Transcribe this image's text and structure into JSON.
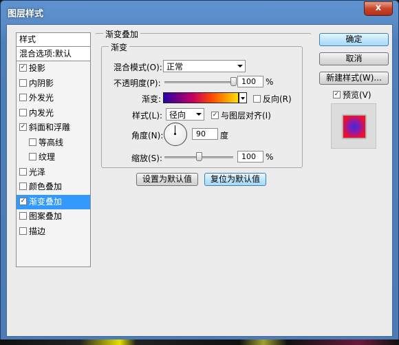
{
  "window": {
    "title": "图层样式",
    "close_glyph": "x"
  },
  "style_list": {
    "header": "样式",
    "blend": "混合选项:默认",
    "items": [
      {
        "label": "投影",
        "checked": true,
        "sub": false,
        "selected": false
      },
      {
        "label": "内阴影",
        "checked": false,
        "sub": false,
        "selected": false
      },
      {
        "label": "外发光",
        "checked": false,
        "sub": false,
        "selected": false
      },
      {
        "label": "内发光",
        "checked": false,
        "sub": false,
        "selected": false
      },
      {
        "label": "斜面和浮雕",
        "checked": true,
        "sub": false,
        "selected": false
      },
      {
        "label": "等高线",
        "checked": false,
        "sub": true,
        "selected": false
      },
      {
        "label": "纹理",
        "checked": false,
        "sub": true,
        "selected": false
      },
      {
        "label": "光泽",
        "checked": false,
        "sub": false,
        "selected": false
      },
      {
        "label": "颜色叠加",
        "checked": false,
        "sub": false,
        "selected": false
      },
      {
        "label": "渐变叠加",
        "checked": true,
        "sub": false,
        "selected": true
      },
      {
        "label": "图案叠加",
        "checked": false,
        "sub": false,
        "selected": false
      },
      {
        "label": "描边",
        "checked": false,
        "sub": false,
        "selected": false
      }
    ]
  },
  "panel": {
    "outer_title": "渐变叠加",
    "inner_title": "渐变",
    "blend_mode_label": "混合模式(O):",
    "blend_mode_value": "正常",
    "opacity_label": "不透明度(P):",
    "opacity_value": "100",
    "opacity_unit": "%",
    "opacity_level": 1.0,
    "gradient_label": "渐变:",
    "reverse_label": "反向(R)",
    "reverse_checked": false,
    "style_label": "样式(L):",
    "style_value": "径向",
    "align_label": "与图层对齐(I)",
    "align_checked": true,
    "angle_label": "角度(N):",
    "angle_value": "90",
    "angle_unit": "度",
    "scale_label": "缩放(S):",
    "scale_value": "100",
    "scale_unit": "%",
    "scale_level": 0.5,
    "make_default": "设置为默认值",
    "reset_default": "复位为默认值"
  },
  "buttons": {
    "ok": "确定",
    "cancel": "取消",
    "new_style": "新建样式(W)...",
    "preview_label": "预览(V)",
    "preview_checked": true
  },
  "colors": {
    "selected_bg": "#3399ff",
    "gradient_stops": [
      "#2800a8",
      "#c80060",
      "#ff4a00",
      "#ffe000"
    ]
  }
}
